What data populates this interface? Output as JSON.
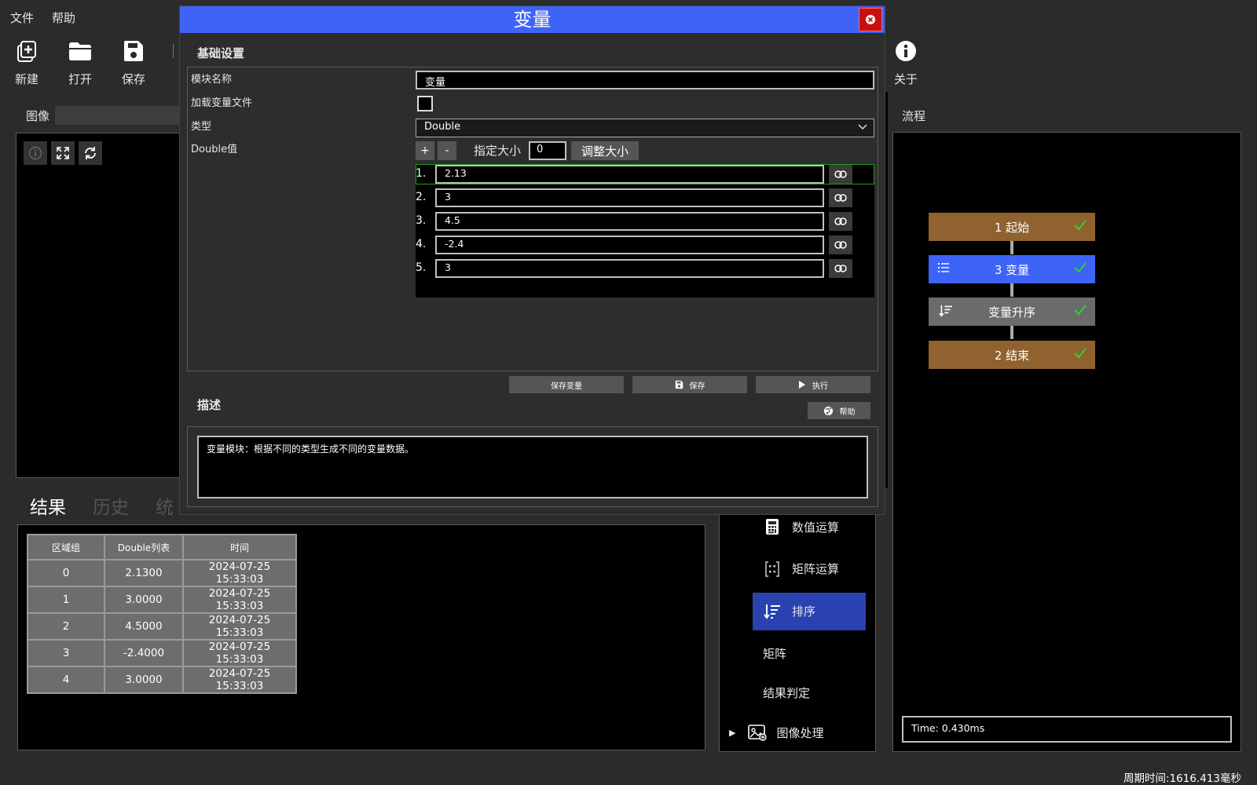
{
  "menu": {
    "file": "文件",
    "help": "帮助"
  },
  "toolbar": {
    "new": "新建",
    "open": "打开",
    "save": "保存",
    "about": "关于"
  },
  "image_panel": {
    "title": "图像"
  },
  "flow_panel": {
    "title": "流程",
    "nodes": [
      {
        "label": "1 起始",
        "color": "#8f6230"
      },
      {
        "label": "3 变量",
        "color": "#3e63f7"
      },
      {
        "label": "变量升序",
        "color": "#6b6b6b"
      },
      {
        "label": "2 结束",
        "color": "#8f6230"
      }
    ],
    "time": "Time: 0.430ms"
  },
  "result_tabs": {
    "result": "结果",
    "history": "历史",
    "stats": "统"
  },
  "result_table": {
    "headers": [
      "区域组",
      "Double列表",
      "时间"
    ],
    "rows": [
      [
        "0",
        "2.1300",
        "2024-07-25 15:33:03"
      ],
      [
        "1",
        "3.0000",
        "2024-07-25 15:33:03"
      ],
      [
        "2",
        "4.5000",
        "2024-07-25 15:33:03"
      ],
      [
        "3",
        "-2.4000",
        "2024-07-25 15:33:03"
      ],
      [
        "4",
        "3.0000",
        "2024-07-25 15:33:03"
      ]
    ]
  },
  "tool_list": {
    "items": [
      {
        "label": "数值运算",
        "icon": "calculator-icon"
      },
      {
        "label": "矩阵运算",
        "icon": "matrix-icon"
      },
      {
        "label": "排序",
        "icon": "sort-icon",
        "selected": true
      },
      {
        "label": "矩阵",
        "icon": ""
      },
      {
        "label": "结果判定",
        "icon": ""
      },
      {
        "label": "图像处理",
        "icon": "image-process-icon"
      }
    ]
  },
  "dialog": {
    "title": "变量",
    "section_basic": "基础设置",
    "module_name_label": "模块名称",
    "module_name_value": "变量",
    "load_file_label": "加载变量文件",
    "type_label": "类型",
    "type_value": "Double",
    "double_value_label": "Double值",
    "plus": "+",
    "minus": "-",
    "size_label": "指定大小",
    "size_value": "0",
    "resize_button": "调整大小",
    "values": [
      {
        "idx": "1.",
        "value": "2.13"
      },
      {
        "idx": "2.",
        "value": "3"
      },
      {
        "idx": "3.",
        "value": "4.5"
      },
      {
        "idx": "4.",
        "value": "-2.4"
      },
      {
        "idx": "5.",
        "value": "3"
      }
    ],
    "save_var_button": "保存变量",
    "save_button": "保存",
    "exec_button": "执行",
    "section_desc": "描述",
    "help_button": "帮助",
    "description": "变量模块：根据不同的类型生成不同的变量数据。"
  },
  "status": {
    "cycle_time": "周期时间:1616.413毫秒"
  }
}
